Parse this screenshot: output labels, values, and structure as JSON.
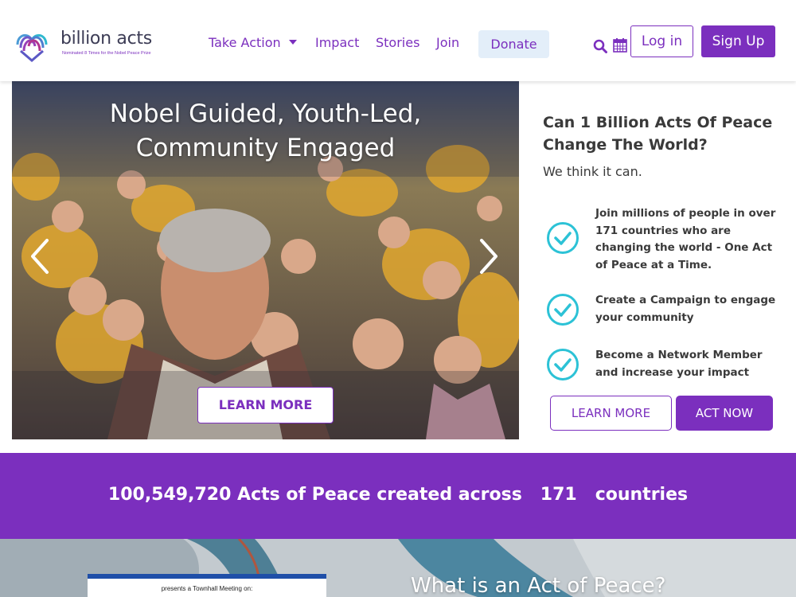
{
  "brand": {
    "name": "billion acts",
    "tagline": "Nominated 8 Times for the Nobel Peace Prize",
    "colors": {
      "primary": "#7b2fbe",
      "donate_bg": "#e3eef9",
      "check": "#2cc2d6"
    }
  },
  "nav": {
    "items": [
      {
        "label": "Take Action"
      },
      {
        "label": "Impact"
      },
      {
        "label": "Stories"
      },
      {
        "label": "Join"
      }
    ],
    "donate": "Donate",
    "login": "Log in",
    "signup": "Sign Up",
    "icons": [
      "search-icon",
      "calendar-icon"
    ]
  },
  "hero": {
    "title_line1": "Nobel Guided, Youth-Led,",
    "title_line2": "Community Engaged",
    "cta": "LEARN MORE"
  },
  "side": {
    "title": "Can 1 Billion Acts Of Peace Change The World?",
    "subtitle": "We think it can.",
    "features": [
      {
        "text": "Join millions of people in over 171 countries who are changing the world - One Act of Peace at a Time."
      },
      {
        "text": "Create a Campaign to engage your community"
      },
      {
        "text": "Become a Network Member and increase your impact"
      }
    ],
    "learn_more": "LEARN MORE",
    "act_now": "ACT NOW"
  },
  "stats": {
    "count": "100,549,720",
    "mid": "Acts of Peace created across",
    "countries": "171",
    "suffix": "countries"
  },
  "bottom": {
    "flyer_text": "presents a Townhall Meeting on:",
    "title": "What is an Act of Peace?"
  }
}
